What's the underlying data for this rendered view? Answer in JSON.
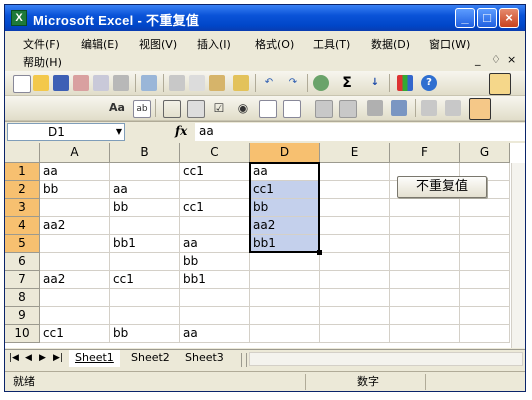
{
  "window": {
    "title": "Microsoft Excel - 不重复值",
    "app_icon": "X",
    "minimize": "_",
    "maximize": "□",
    "close": "×"
  },
  "menu": {
    "items": [
      {
        "label": "文件",
        "key": "(F)"
      },
      {
        "label": "编辑",
        "key": "(E)"
      },
      {
        "label": "视图",
        "key": "(V)"
      },
      {
        "label": "插入",
        "key": "(I)"
      },
      {
        "label": "格式",
        "key": "(O)"
      },
      {
        "label": "工具",
        "key": "(T)"
      },
      {
        "label": "数据",
        "key": "(D)"
      },
      {
        "label": "窗口",
        "key": "(W)"
      },
      {
        "label": "帮助",
        "key": "(H)"
      }
    ],
    "doc_controls": [
      "_",
      "♢",
      "×"
    ]
  },
  "toolbar": {
    "standard_icons": [
      "new-icon",
      "open-icon",
      "save-icon",
      "permission-icon",
      "print-preview-icon",
      "print-icon",
      "spelling-icon",
      "cut-icon",
      "copy-icon",
      "paste-icon",
      "format-painter-icon",
      "undo-icon",
      "redo-icon",
      "hyperlink-icon",
      "autosum-icon",
      "sort-ascending-icon",
      "chart-wizard-icon",
      "help-icon"
    ],
    "forms_icons": [
      "label-icon",
      "edit-box-icon",
      "group-box-icon",
      "button-icon",
      "checkbox-icon",
      "option-button-icon",
      "list-box-icon",
      "combo-box-icon",
      "toggle-grid-icon",
      "properties-icon",
      "run-dialog-icon",
      "tab-order-icon",
      "control-icon"
    ],
    "autosum_glyph": "Σ"
  },
  "formula_bar": {
    "name_box": "D1",
    "fx": "fx",
    "value": "aa"
  },
  "sheet": {
    "columns": [
      "A",
      "B",
      "C",
      "D",
      "E",
      "F",
      "G"
    ],
    "rows": [
      {
        "num": "1",
        "cells": [
          "aa",
          "",
          "cc1",
          "aa",
          "",
          "",
          ""
        ]
      },
      {
        "num": "2",
        "cells": [
          "bb",
          "aa",
          "",
          "cc1",
          "",
          "",
          ""
        ]
      },
      {
        "num": "3",
        "cells": [
          "",
          "bb",
          "cc1",
          "bb",
          "",
          "",
          ""
        ]
      },
      {
        "num": "4",
        "cells": [
          "aa2",
          "",
          "",
          "aa2",
          "",
          "",
          ""
        ]
      },
      {
        "num": "5",
        "cells": [
          "",
          "bb1",
          "aa",
          "bb1",
          "",
          "",
          ""
        ]
      },
      {
        "num": "6",
        "cells": [
          "",
          "",
          "bb",
          "",
          "",
          "",
          ""
        ]
      },
      {
        "num": "7",
        "cells": [
          "aa2",
          "cc1",
          "bb1",
          "",
          "",
          "",
          ""
        ]
      },
      {
        "num": "8",
        "cells": [
          "",
          "",
          "",
          "",
          "",
          "",
          ""
        ]
      },
      {
        "num": "9",
        "cells": [
          "",
          "",
          "",
          "",
          "",
          "",
          ""
        ]
      },
      {
        "num": "10",
        "cells": [
          "cc1",
          "bb",
          "aa",
          "",
          "",
          "",
          ""
        ]
      }
    ],
    "selected_column": "D",
    "selected_rows": [
      "1",
      "2",
      "3",
      "4",
      "5"
    ],
    "button_label": "不重复值"
  },
  "tabs": {
    "nav": [
      "|◀",
      "◀",
      "▶",
      "▶|"
    ],
    "sheets": [
      "Sheet1",
      "Sheet2",
      "Sheet3"
    ],
    "active": "Sheet1"
  },
  "status": {
    "left": "就绪",
    "mode": "数字"
  },
  "colors": {
    "title_bar": "#0a53d8",
    "selection_header": "#f7c070",
    "selection_fill": "#c4d0ec"
  }
}
